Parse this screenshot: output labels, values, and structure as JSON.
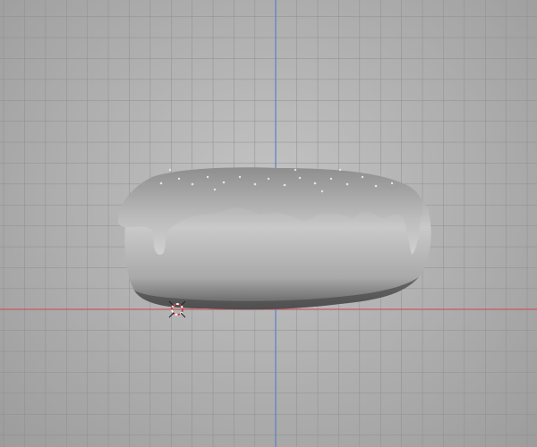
{
  "viewport": {
    "name": "3D Viewport",
    "object": "donut",
    "colors": {
      "x_axis": "#c85a64",
      "y_axis": "#5b82c0",
      "grid": "#8e8e8e",
      "mesh": "#b8b8b8"
    }
  }
}
